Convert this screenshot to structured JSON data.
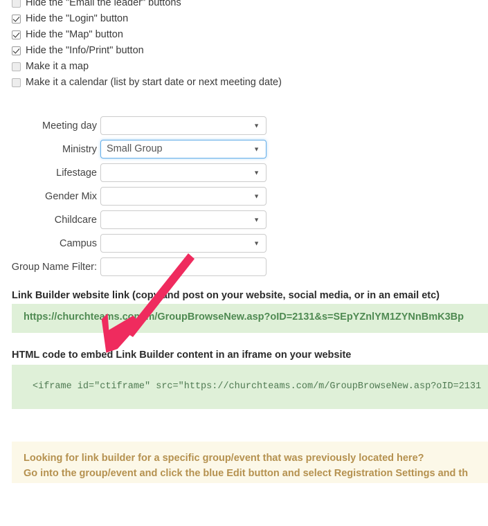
{
  "checkboxes": [
    {
      "label": "Hide the \"Email the leader\" buttons",
      "checked": false
    },
    {
      "label": "Hide the \"Login\" button",
      "checked": true
    },
    {
      "label": "Hide the \"Map\" button",
      "checked": true
    },
    {
      "label": "Hide the \"Info/Print\" button",
      "checked": true
    },
    {
      "label": "Make it a map",
      "checked": false
    },
    {
      "label": "Make it a calendar (list by start date or next meeting date)",
      "checked": false
    }
  ],
  "form": {
    "fields": [
      {
        "label": "Meeting day",
        "value": "",
        "type": "select",
        "focused": false
      },
      {
        "label": "Ministry",
        "value": "Small Group",
        "type": "select",
        "focused": true
      },
      {
        "label": "Lifestage",
        "value": "",
        "type": "select",
        "focused": false
      },
      {
        "label": "Gender Mix",
        "value": "",
        "type": "select",
        "focused": false
      },
      {
        "label": "Childcare",
        "value": "",
        "type": "select",
        "focused": false
      },
      {
        "label": "Campus",
        "value": "",
        "type": "select",
        "focused": false
      },
      {
        "label": "Group Name Filter:",
        "value": "",
        "type": "text",
        "focused": false
      }
    ],
    "caret_glyph": "▼"
  },
  "link_section": {
    "heading": "Link Builder website link (copy and post on your website, social media, or in an email etc)",
    "url": "https://churchteams.com/m/GroupBrowseNew.asp?oID=2131&s=SEpYZnlYM1ZYNnBmK3Bp"
  },
  "iframe_section": {
    "heading": "HTML code to embed Link Builder content in an iframe on your website",
    "code": "<iframe id=\"ctiframe\" src=\"https://churchteams.com/m/GroupBrowseNew.asp?oID=2131"
  },
  "alert": {
    "line1": "Looking for link builder for a specific group/event that was previously located here?",
    "line2": "Go into the group/event and click the blue Edit button and select Registration Settings and th"
  },
  "annotation": {
    "arrow_name": "red-arrow-annotation",
    "color": "#ef2b5e"
  }
}
